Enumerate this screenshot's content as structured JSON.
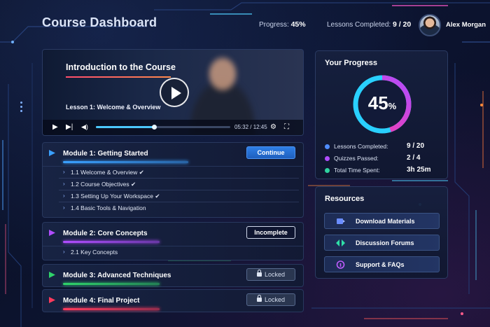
{
  "header": {
    "title": "Course Dashboard",
    "progress_label": "Progress:",
    "progress_value": "45%",
    "lessons_label": "Lessons Completed:",
    "lessons_value": "9 / 20",
    "user_name": "Alex Morgan"
  },
  "video": {
    "title": "Introduction to the Course",
    "lesson": "Lesson 1: Welcome & Overview",
    "time": "05:32 / 12:45",
    "progress": 0.43
  },
  "modules": [
    {
      "title": "Module 1: Getting Started",
      "button": "Continue",
      "color": "#3aa0ff",
      "progress": 0.78,
      "lessons": [
        "1.1 Welcome & Overview ✔",
        "1.2 Course Objectives ✔",
        "1.3 Setting Up Your Workspace ✔",
        "1.4 Basic Tools & Navigation"
      ]
    },
    {
      "title": "Module 2: Core Concepts",
      "button": "Incomplete",
      "color": "#b04dff",
      "progress": 0.6,
      "lessons": [
        "2.1 Key Concepts"
      ]
    },
    {
      "title": "Module 3: Advanced Techniques",
      "button": "Locked",
      "color": "#2fd36a",
      "progress": 0.6,
      "lessons": []
    },
    {
      "title": "Module 4: Final Project",
      "button": "Locked",
      "color": "#ff3a5c",
      "progress": 0.6,
      "lessons": []
    }
  ],
  "your_progress": {
    "title": "Your Progress",
    "percent_number": "45",
    "percent_sign": "%",
    "percent": 0.45,
    "rows": [
      {
        "label": "Lessons Completed:",
        "value": "9 / 20",
        "color": "#4f8dff"
      },
      {
        "label": "Quizzes Passed:",
        "value": "2 / 4",
        "color": "#b04dff"
      },
      {
        "label": "Total Time Spent:",
        "value": "3h 25m",
        "color": "#2fd3a0"
      }
    ]
  },
  "resources": {
    "title": "Resources",
    "items": [
      {
        "label": "Download Materials",
        "icon": "download-icon",
        "color": "#6a8dff"
      },
      {
        "label": "Discussion Forums",
        "icon": "forum-icon",
        "color": "#2fe0a8"
      },
      {
        "label": "Support & FAQs",
        "icon": "support-icon",
        "color": "#c05cff"
      }
    ]
  }
}
